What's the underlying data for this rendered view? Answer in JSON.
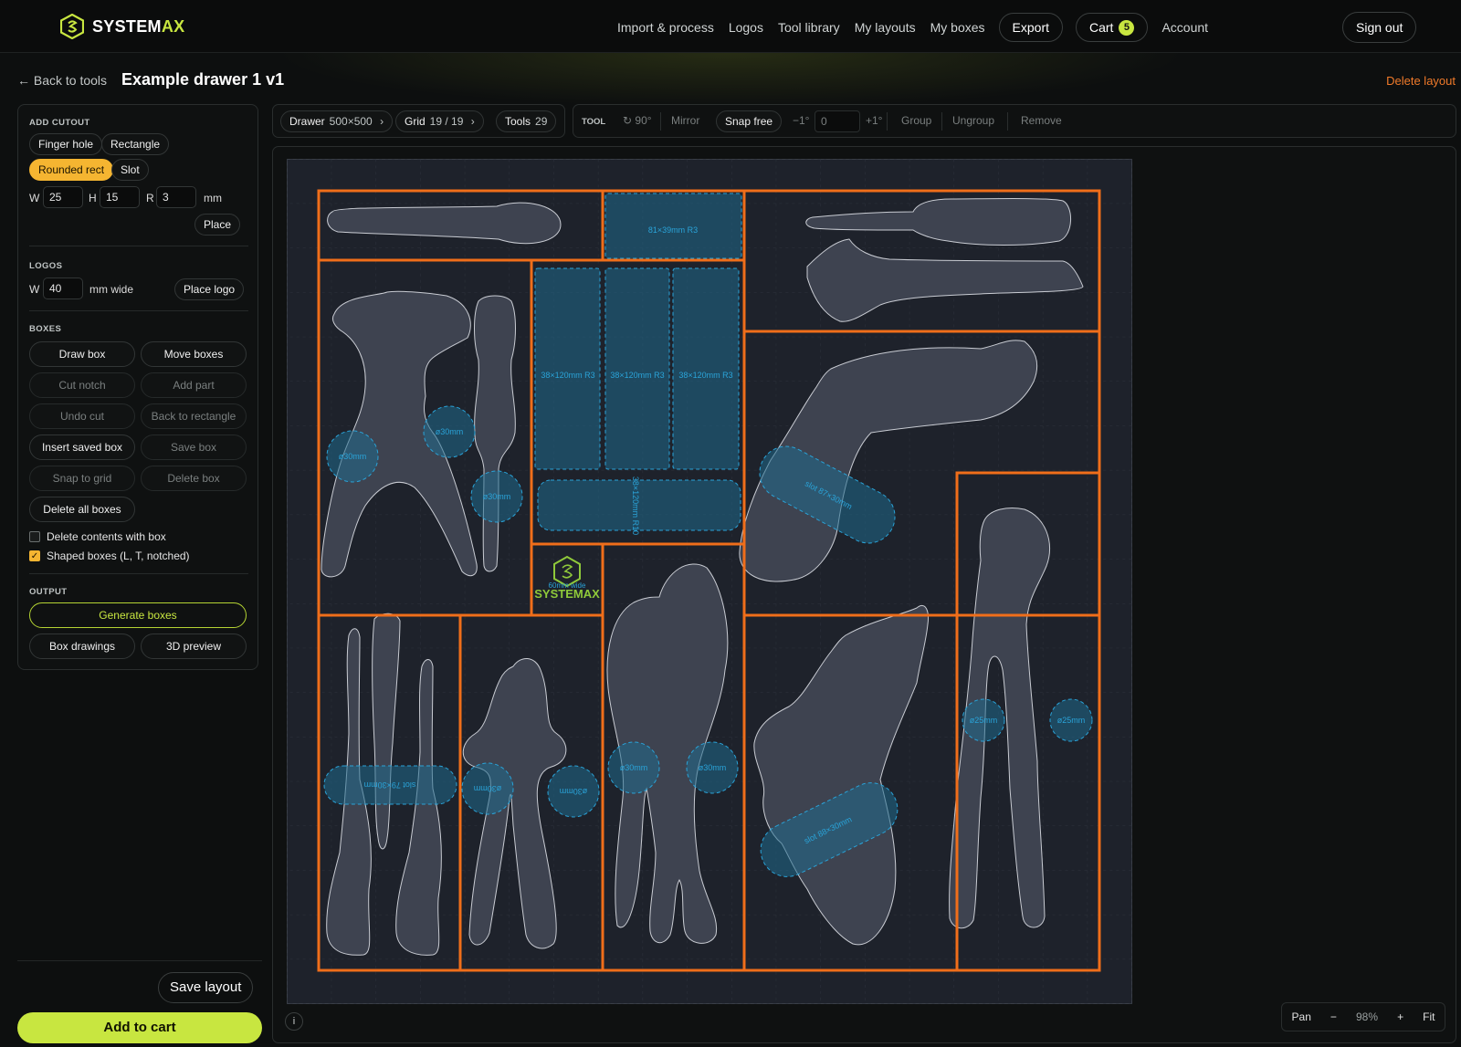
{
  "brand": {
    "name_main": "SYSTEM",
    "name_accent": "AX",
    "accent_color": "#c8e640"
  },
  "nav": {
    "links": [
      "Import & process",
      "Logos",
      "Tool library",
      "My layouts",
      "My boxes"
    ],
    "export_label": "Export",
    "cart_label": "Cart",
    "cart_count": "5",
    "account_label": "Account",
    "signout_label": "Sign out"
  },
  "header": {
    "back_label": "← Back to tools",
    "title": "Example drawer 1 v1",
    "delete_label": "Delete layout"
  },
  "sidebar": {
    "add_cutout": {
      "title": "ADD CUTOUT",
      "shapes": [
        "Finger hole",
        "Rectangle",
        "Rounded rect",
        "Slot"
      ],
      "active_shape": "Rounded rect",
      "w_label": "W",
      "w_value": "25",
      "h_label": "H",
      "h_value": "15",
      "r_label": "R",
      "r_value": "3",
      "unit": "mm",
      "place_label": "Place"
    },
    "logos": {
      "title": "LOGOS",
      "w_label": "W",
      "w_value": "40",
      "unit": "mm wide",
      "place_label": "Place logo"
    },
    "boxes": {
      "title": "BOXES",
      "draw": "Draw box",
      "move": "Move boxes",
      "cut_notch": "Cut notch",
      "add_part": "Add part",
      "undo_cut": "Undo cut",
      "back_rect": "Back to rectangle",
      "insert_saved": "Insert saved box",
      "save_box": "Save box",
      "snap_grid": "Snap to grid",
      "delete_box": "Delete box",
      "delete_all": "Delete all boxes",
      "delete_contents": "Delete contents with box",
      "delete_contents_checked": false,
      "shaped_boxes": "Shaped boxes (L, T, notched)",
      "shaped_boxes_checked": true
    },
    "output": {
      "title": "OUTPUT",
      "generate": "Generate boxes",
      "drawings": "Box drawings",
      "preview": "3D preview"
    },
    "save_layout": "Save layout",
    "add_to_cart": "Add to cart"
  },
  "toolbar": {
    "drawer_label": "Drawer",
    "drawer_value": "500×500",
    "grid_label": "Grid",
    "grid_value": "19 / 19",
    "tools_label": "Tools",
    "tools_value": "29",
    "tool_title": "TOOL",
    "rotate": "↻ 90°",
    "mirror": "Mirror",
    "snap": "Snap free",
    "minus_deg": "−1°",
    "angle_value": "0",
    "plus_deg": "+1°",
    "group": "Group",
    "ungroup": "Ungroup",
    "remove": "Remove"
  },
  "canvas": {
    "colors": {
      "box_stroke": "#f06e1a",
      "tool_fill": "#3e4350",
      "cutout_fill": "#1f6a8c",
      "cutout_stroke": "#2aa3d8",
      "drawer_bg": "#1e222b"
    },
    "cutout_labels": {
      "top_rect": "81×39mm R3",
      "rect1": "38×120mm R3",
      "rect2": "38×120mm R3",
      "rect3": "38×120mm R3",
      "rect_horizontal": "38×120mm R10",
      "hole_a": "ø30mm",
      "hole_b": "ø30mm",
      "hole_c": "ø30mm",
      "slot_drill": "slot 87×30mm",
      "slot_screwdrivers": "slot 79×30mm",
      "hole_pliers1": "ø30mm",
      "hole_pliers2": "ø30mm",
      "hole_long1": "ø30mm",
      "hole_long2": "ø30mm",
      "slot_angle": "slot 88×30mm",
      "hole_right1": "ø25mm",
      "hole_right2": "ø25mm"
    },
    "logo_text": "SYSTEMAX",
    "logo_size_label": "60mm wide",
    "info": "i"
  },
  "zoom": {
    "pan": "Pan",
    "minus": "−",
    "level": "98%",
    "plus": "+",
    "fit": "Fit"
  }
}
